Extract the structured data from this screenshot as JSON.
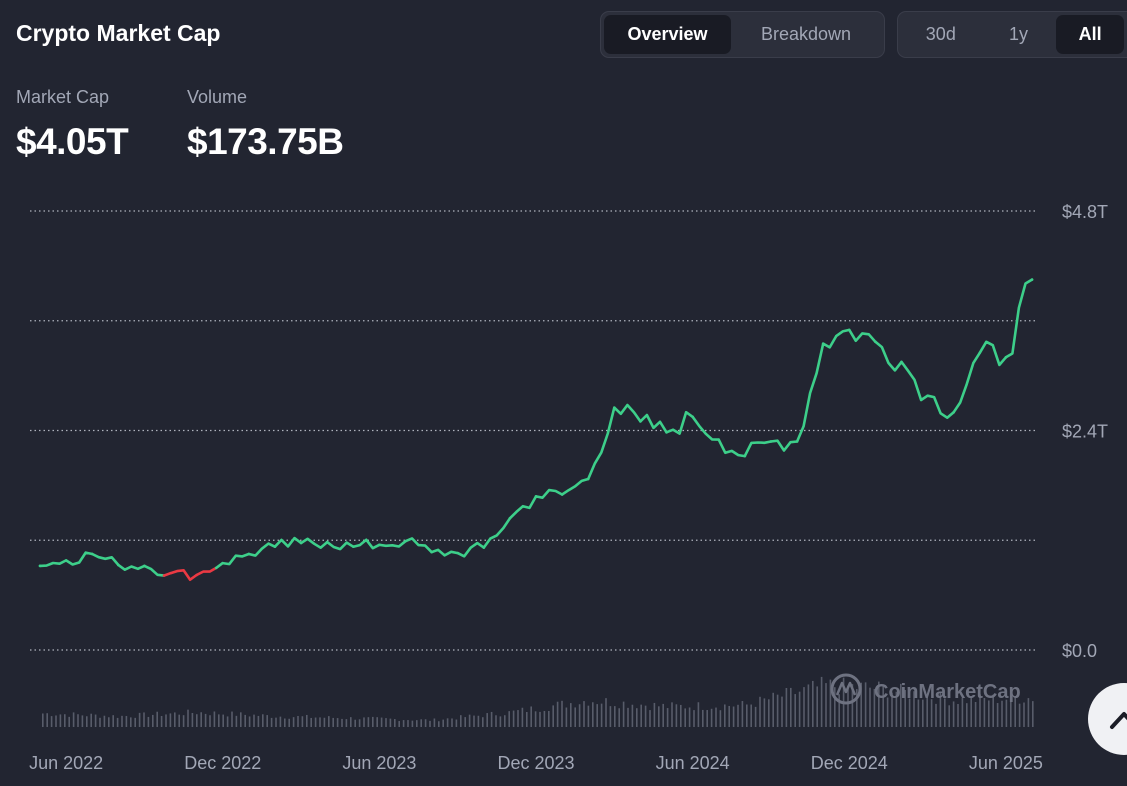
{
  "header": {
    "title": "Crypto Market Cap",
    "view_tabs": [
      {
        "label": "Overview",
        "active": true
      },
      {
        "label": "Breakdown",
        "active": false
      }
    ],
    "range_tabs": [
      {
        "label": "30d",
        "active": false
      },
      {
        "label": "1y",
        "active": false
      },
      {
        "label": "All",
        "active": true
      }
    ]
  },
  "stats": {
    "market_cap_label": "Market Cap",
    "market_cap_value": "$4.05T",
    "volume_label": "Volume",
    "volume_value": "$173.75B"
  },
  "watermark": "CoinMarketCap",
  "colors": {
    "background": "#222531",
    "up": "#3dcf8a",
    "down": "#ea3943",
    "grid": "#c8ccd6",
    "axis_text": "#a2a7b6",
    "volume_bar": "#585c6a"
  },
  "chart_data": {
    "type": "line",
    "title": "",
    "xlabel": "",
    "ylabel": "",
    "ylim": [
      0,
      4.8
    ],
    "y_unit": "trillion USD",
    "y_ticks": [
      "$0.0",
      "$2.4T",
      "$4.8T"
    ],
    "y_tick_values": [
      0,
      2.4,
      4.8
    ],
    "grid": true,
    "grid_values": [
      0,
      1.2,
      2.4,
      3.6,
      4.8
    ],
    "x_tick_labels": [
      "Jun 2022",
      "Dec 2022",
      "Jun 2023",
      "Dec 2023",
      "Jun 2024",
      "Dec 2024",
      "Jun 2025"
    ],
    "x_tick_dates": [
      "2022-06",
      "2022-12",
      "2023-06",
      "2023-12",
      "2024-06",
      "2024-12",
      "2025-06"
    ],
    "x_start": "2022-05",
    "x_end": "2025-07",
    "series": [
      {
        "down_segment": [
          "2022-10",
          "2022-11"
        ],
        "x": [
          "2022-05",
          "2022-06",
          "2022-07",
          "2022-08",
          "2022-09",
          "2022-10",
          "2022-11",
          "2022-12",
          "2023-01",
          "2023-02",
          "2023-03",
          "2023-04",
          "2023-05",
          "2023-06",
          "2023-07",
          "2023-08",
          "2023-09",
          "2023-10",
          "2023-11",
          "2023-12",
          "2024-01",
          "2024-02",
          "2024-03",
          "2024-04",
          "2024-05",
          "2024-06",
          "2024-07",
          "2024-08",
          "2024-09",
          "2024-10",
          "2024-11",
          "2024-12",
          "2025-01",
          "2025-02",
          "2025-03",
          "2025-04",
          "2025-05",
          "2025-06",
          "2025-07"
        ],
        "values": [
          0.92,
          0.98,
          1.05,
          0.93,
          0.92,
          0.84,
          0.82,
          0.95,
          1.05,
          1.13,
          1.17,
          1.18,
          1.13,
          1.15,
          1.19,
          1.07,
          1.06,
          1.12,
          1.44,
          1.68,
          1.7,
          1.87,
          2.65,
          2.5,
          2.38,
          2.55,
          2.3,
          2.12,
          2.28,
          2.28,
          3.35,
          3.5,
          3.37,
          3.15,
          2.78,
          2.6,
          3.25,
          3.2,
          4.05
        ]
      }
    ],
    "volume": {
      "unit": "relative",
      "x": [
        "2022-05",
        "2022-08",
        "2022-11",
        "2023-02",
        "2023-05",
        "2023-08",
        "2023-11",
        "2024-02",
        "2024-05",
        "2024-08",
        "2024-11",
        "2025-01",
        "2025-04",
        "2025-07"
      ],
      "values": [
        0.28,
        0.22,
        0.3,
        0.22,
        0.18,
        0.14,
        0.3,
        0.55,
        0.42,
        0.45,
        0.85,
        0.8,
        0.55,
        0.6
      ]
    }
  }
}
